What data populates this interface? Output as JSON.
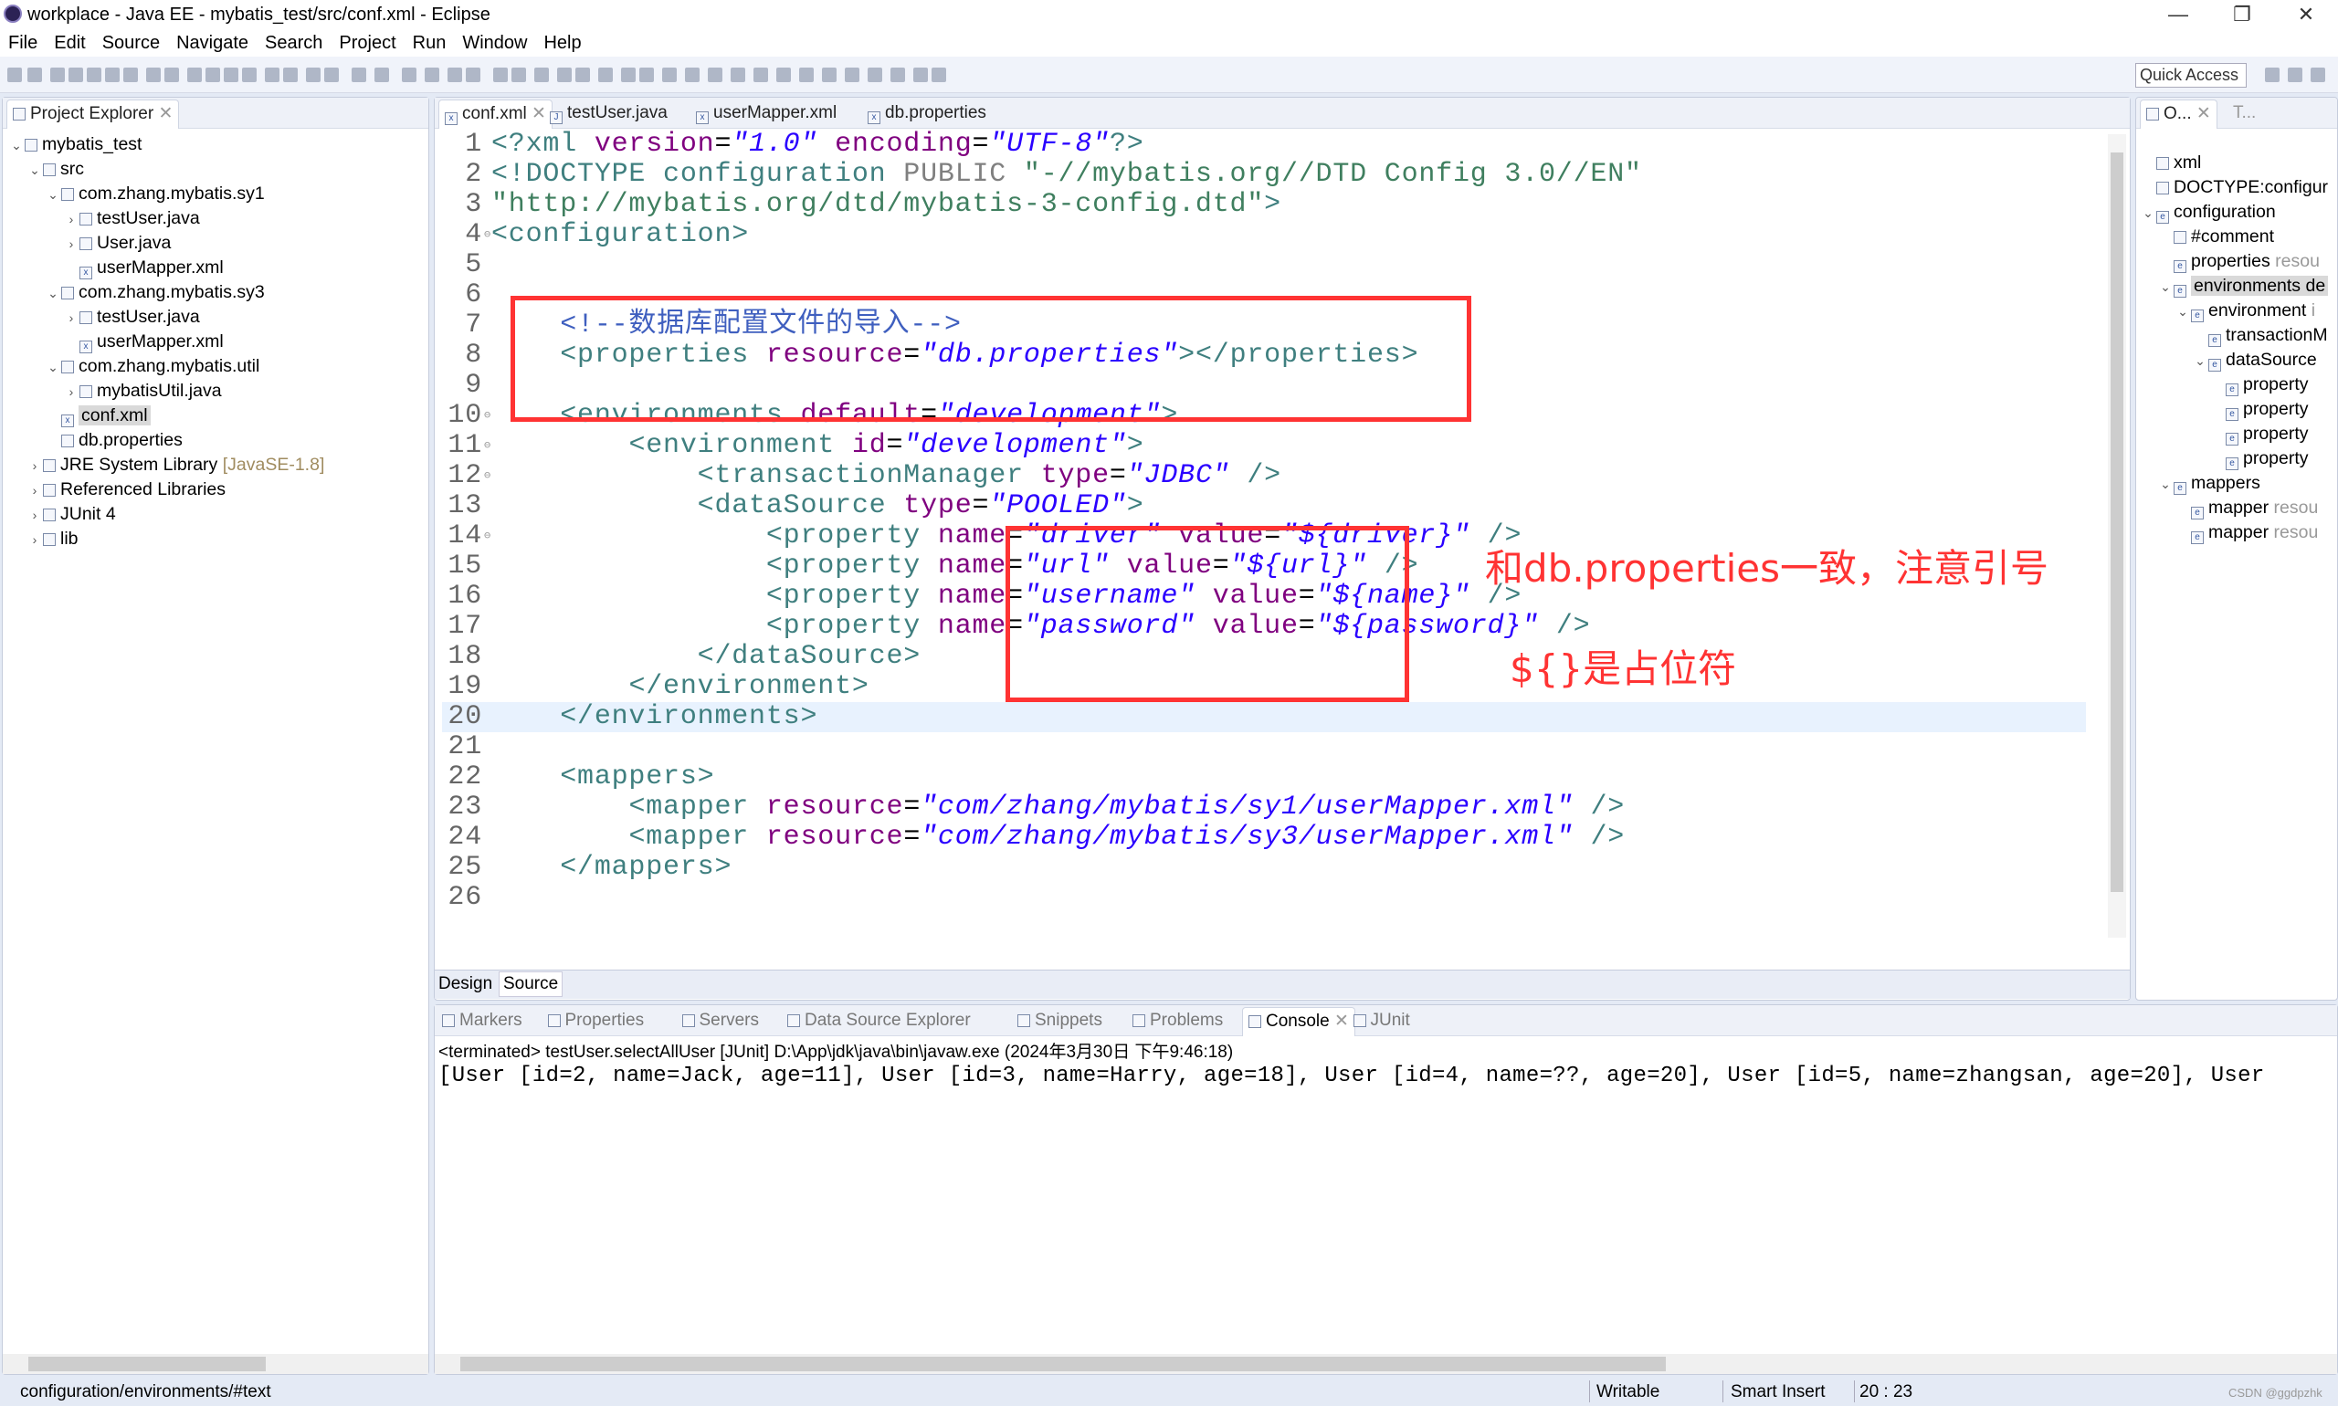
{
  "window": {
    "title": "workplace - Java EE - mybatis_test/src/conf.xml - Eclipse",
    "controls": [
      "—",
      "❐",
      "✕"
    ]
  },
  "menu": [
    "File",
    "Edit",
    "Source",
    "Navigate",
    "Search",
    "Project",
    "Run",
    "Window",
    "Help"
  ],
  "toolbar": {
    "quick_access": "Quick Access"
  },
  "explorer": {
    "title": "Project Explorer",
    "items": [
      {
        "level": 0,
        "exp": "v",
        "icon": "project-icon",
        "label": "mybatis_test"
      },
      {
        "level": 1,
        "exp": "v",
        "icon": "source-folder-icon",
        "label": "src"
      },
      {
        "level": 2,
        "exp": "v",
        "icon": "package-icon",
        "label": "com.zhang.mybatis.sy1"
      },
      {
        "level": 3,
        "exp": ">",
        "icon": "java-file-icon",
        "label": "testUser.java"
      },
      {
        "level": 3,
        "exp": ">",
        "icon": "java-file-icon",
        "label": "User.java"
      },
      {
        "level": 3,
        "exp": "",
        "icon": "xml-file-icon",
        "label": "userMapper.xml"
      },
      {
        "level": 2,
        "exp": "v",
        "icon": "package-icon",
        "label": "com.zhang.mybatis.sy3"
      },
      {
        "level": 3,
        "exp": ">",
        "icon": "java-file-icon",
        "label": "testUser.java"
      },
      {
        "level": 3,
        "exp": "",
        "icon": "xml-file-icon",
        "label": "userMapper.xml"
      },
      {
        "level": 2,
        "exp": "v",
        "icon": "package-icon",
        "label": "com.zhang.mybatis.util"
      },
      {
        "level": 3,
        "exp": ">",
        "icon": "java-file-icon",
        "label": "mybatisUtil.java"
      },
      {
        "level": 2,
        "exp": "",
        "icon": "xml-file-icon",
        "label": "conf.xml",
        "selected": true
      },
      {
        "level": 2,
        "exp": "",
        "icon": "text-file-icon",
        "label": "db.properties"
      },
      {
        "level": 1,
        "exp": ">",
        "icon": "library-icon",
        "label": "JRE System Library",
        "extra": "[JavaSE-1.8]"
      },
      {
        "level": 1,
        "exp": ">",
        "icon": "library-icon",
        "label": "Referenced Libraries"
      },
      {
        "level": 1,
        "exp": ">",
        "icon": "library-icon",
        "label": "JUnit 4"
      },
      {
        "level": 1,
        "exp": ">",
        "icon": "folder-icon",
        "label": "lib"
      }
    ]
  },
  "editor": {
    "tabs": [
      {
        "label": "conf.xml",
        "active": true
      },
      {
        "label": "testUser.java"
      },
      {
        "label": "userMapper.xml"
      },
      {
        "label": "db.properties"
      }
    ],
    "current_line": 20,
    "lines": [
      [
        [
          "tag",
          "<?xml "
        ],
        [
          "an",
          "version"
        ],
        [
          "pl",
          "="
        ],
        [
          "av",
          "\"1.0\""
        ],
        [
          "pl",
          " "
        ],
        [
          "an",
          "encoding"
        ],
        [
          "pl",
          "="
        ],
        [
          "av",
          "\"UTF-8\""
        ],
        [
          "tag",
          "?>"
        ]
      ],
      [
        [
          "tag",
          "<!DOCTYPE configuration "
        ],
        [
          "dt",
          "PUBLIC "
        ],
        [
          "ds",
          "\"-//mybatis.org//DTD Config 3.0//EN\""
        ]
      ],
      [
        [
          "ds",
          "\"http://mybatis.org/dtd/mybatis-3-config.dtd\""
        ],
        [
          "tag",
          ">"
        ]
      ],
      [
        [
          "tag",
          "<configuration>"
        ]
      ],
      [],
      [],
      [
        [
          "pl",
          "    "
        ],
        [
          "cm",
          "<!--数据库配置文件的导入-->"
        ]
      ],
      [
        [
          "pl",
          "    "
        ],
        [
          "tag",
          "<properties "
        ],
        [
          "an",
          "resource"
        ],
        [
          "pl",
          "="
        ],
        [
          "av",
          "\"db.properties\""
        ],
        [
          "tag",
          "></properties>"
        ]
      ],
      [],
      [
        [
          "pl",
          "    "
        ],
        [
          "tag",
          "<environments "
        ],
        [
          "an",
          "default"
        ],
        [
          "pl",
          "="
        ],
        [
          "av",
          "\"development\""
        ],
        [
          "tag",
          ">"
        ]
      ],
      [
        [
          "pl",
          "        "
        ],
        [
          "tag",
          "<environment "
        ],
        [
          "an",
          "id"
        ],
        [
          "pl",
          "="
        ],
        [
          "av",
          "\"development\""
        ],
        [
          "tag",
          ">"
        ]
      ],
      [
        [
          "pl",
          "            "
        ],
        [
          "tag",
          "<transactionManager "
        ],
        [
          "an",
          "type"
        ],
        [
          "pl",
          "="
        ],
        [
          "av",
          "\"JDBC\""
        ],
        [
          "tag",
          " />"
        ]
      ],
      [
        [
          "pl",
          "            "
        ],
        [
          "tag",
          "<dataSource "
        ],
        [
          "an",
          "type"
        ],
        [
          "pl",
          "="
        ],
        [
          "av",
          "\"POOLED\""
        ],
        [
          "tag",
          ">"
        ]
      ],
      [
        [
          "pl",
          "                "
        ],
        [
          "tag",
          "<property "
        ],
        [
          "an",
          "name"
        ],
        [
          "pl",
          "="
        ],
        [
          "av",
          "\"driver\""
        ],
        [
          "pl",
          " "
        ],
        [
          "an",
          "value"
        ],
        [
          "pl",
          "="
        ],
        [
          "av",
          "\"${driver}\""
        ],
        [
          "tag",
          " />"
        ]
      ],
      [
        [
          "pl",
          "                "
        ],
        [
          "tag",
          "<property "
        ],
        [
          "an",
          "name"
        ],
        [
          "pl",
          "="
        ],
        [
          "av",
          "\"url\""
        ],
        [
          "pl",
          " "
        ],
        [
          "an",
          "value"
        ],
        [
          "pl",
          "="
        ],
        [
          "av",
          "\"${url}\""
        ],
        [
          "tag",
          " />"
        ]
      ],
      [
        [
          "pl",
          "                "
        ],
        [
          "tag",
          "<property "
        ],
        [
          "an",
          "name"
        ],
        [
          "pl",
          "="
        ],
        [
          "av",
          "\"username\""
        ],
        [
          "pl",
          " "
        ],
        [
          "an",
          "value"
        ],
        [
          "pl",
          "="
        ],
        [
          "av",
          "\"${name}\""
        ],
        [
          "tag",
          " />"
        ]
      ],
      [
        [
          "pl",
          "                "
        ],
        [
          "tag",
          "<property "
        ],
        [
          "an",
          "name"
        ],
        [
          "pl",
          "="
        ],
        [
          "av",
          "\"password\""
        ],
        [
          "pl",
          " "
        ],
        [
          "an",
          "value"
        ],
        [
          "pl",
          "="
        ],
        [
          "av",
          "\"${password}\""
        ],
        [
          "tag",
          " />"
        ]
      ],
      [
        [
          "pl",
          "            "
        ],
        [
          "tag",
          "</dataSource>"
        ]
      ],
      [
        [
          "pl",
          "        "
        ],
        [
          "tag",
          "</environment>"
        ]
      ],
      [
        [
          "pl",
          "    "
        ],
        [
          "tag",
          "</environments>"
        ]
      ],
      [],
      [
        [
          "pl",
          "    "
        ],
        [
          "tag",
          "<mappers>"
        ]
      ],
      [
        [
          "pl",
          "        "
        ],
        [
          "tag",
          "<mapper "
        ],
        [
          "an",
          "resource"
        ],
        [
          "pl",
          "="
        ],
        [
          "av",
          "\"com/zhang/mybatis/sy1/userMapper.xml\""
        ],
        [
          "tag",
          " />"
        ]
      ],
      [
        [
          "pl",
          "        "
        ],
        [
          "tag",
          "<mapper "
        ],
        [
          "an",
          "resource"
        ],
        [
          "pl",
          "="
        ],
        [
          "av",
          "\"com/zhang/mybatis/sy3/userMapper.xml\""
        ],
        [
          "tag",
          " />"
        ]
      ],
      [
        [
          "pl",
          "    "
        ],
        [
          "tag",
          "</mappers>"
        ]
      ],
      []
    ],
    "fold_lines": [
      4,
      10,
      11,
      12,
      14
    ],
    "bottom_tabs": [
      "Design",
      "Source"
    ],
    "annotations": [
      "和db.properties一致，注意引号",
      "${}是占位符"
    ]
  },
  "outline": {
    "tabs": [
      "O...",
      "T..."
    ],
    "items": [
      {
        "level": 0,
        "exp": "",
        "icon": "pi-icon",
        "label": "xml"
      },
      {
        "level": 0,
        "exp": "",
        "icon": "doctype-icon",
        "label": "DOCTYPE:configur"
      },
      {
        "level": 0,
        "exp": "v",
        "icon": "element-icon",
        "label": "configuration"
      },
      {
        "level": 1,
        "exp": "",
        "icon": "comment-icon",
        "label": "#comment"
      },
      {
        "level": 1,
        "exp": "",
        "icon": "element-icon",
        "label": "properties",
        "extra": "resou"
      },
      {
        "level": 1,
        "exp": "v",
        "icon": "element-icon",
        "label": "environments de",
        "selected": true
      },
      {
        "level": 2,
        "exp": "v",
        "icon": "element-icon",
        "label": "environment",
        "extra": "i"
      },
      {
        "level": 3,
        "exp": "",
        "icon": "element-icon",
        "label": "transactionM"
      },
      {
        "level": 3,
        "exp": "v",
        "icon": "element-icon",
        "label": "dataSource"
      },
      {
        "level": 4,
        "exp": "",
        "icon": "element-icon",
        "label": "property"
      },
      {
        "level": 4,
        "exp": "",
        "icon": "element-icon",
        "label": "property"
      },
      {
        "level": 4,
        "exp": "",
        "icon": "element-icon",
        "label": "property"
      },
      {
        "level": 4,
        "exp": "",
        "icon": "element-icon",
        "label": "property"
      },
      {
        "level": 1,
        "exp": "v",
        "icon": "element-icon",
        "label": "mappers"
      },
      {
        "level": 2,
        "exp": "",
        "icon": "element-icon",
        "label": "mapper",
        "extra": "resou"
      },
      {
        "level": 2,
        "exp": "",
        "icon": "element-icon",
        "label": "mapper",
        "extra": "resou"
      }
    ]
  },
  "console": {
    "tabs": [
      {
        "label": "Markers"
      },
      {
        "label": "Properties"
      },
      {
        "label": "Servers"
      },
      {
        "label": "Data Source Explorer"
      },
      {
        "label": "Snippets"
      },
      {
        "label": "Problems"
      },
      {
        "label": "Console",
        "active": true
      },
      {
        "label": "JUnit"
      }
    ],
    "header": "<terminated> testUser.selectAllUser [JUnit] D:\\App\\jdk\\java\\bin\\javaw.exe (2024年3月30日 下午9:46:18)",
    "output": "[User [id=2, name=Jack, age=11], User [id=3, name=Harry, age=18], User [id=4, name=??, age=20], User [id=5, name=zhangsan, age=20], User"
  },
  "status": {
    "path": "configuration/environments/#text",
    "writable": "Writable",
    "insert": "Smart Insert",
    "position": "20 : 23",
    "watermark": "CSDN @ggdpzhk"
  },
  "colors": {
    "annotation": "#ff3333",
    "current_line": "#e8f2fe",
    "tag": "#3f7f7f",
    "attr_name": "#7f007f",
    "attr_value": "#2a00ff",
    "comment": "#3f5fbf"
  }
}
